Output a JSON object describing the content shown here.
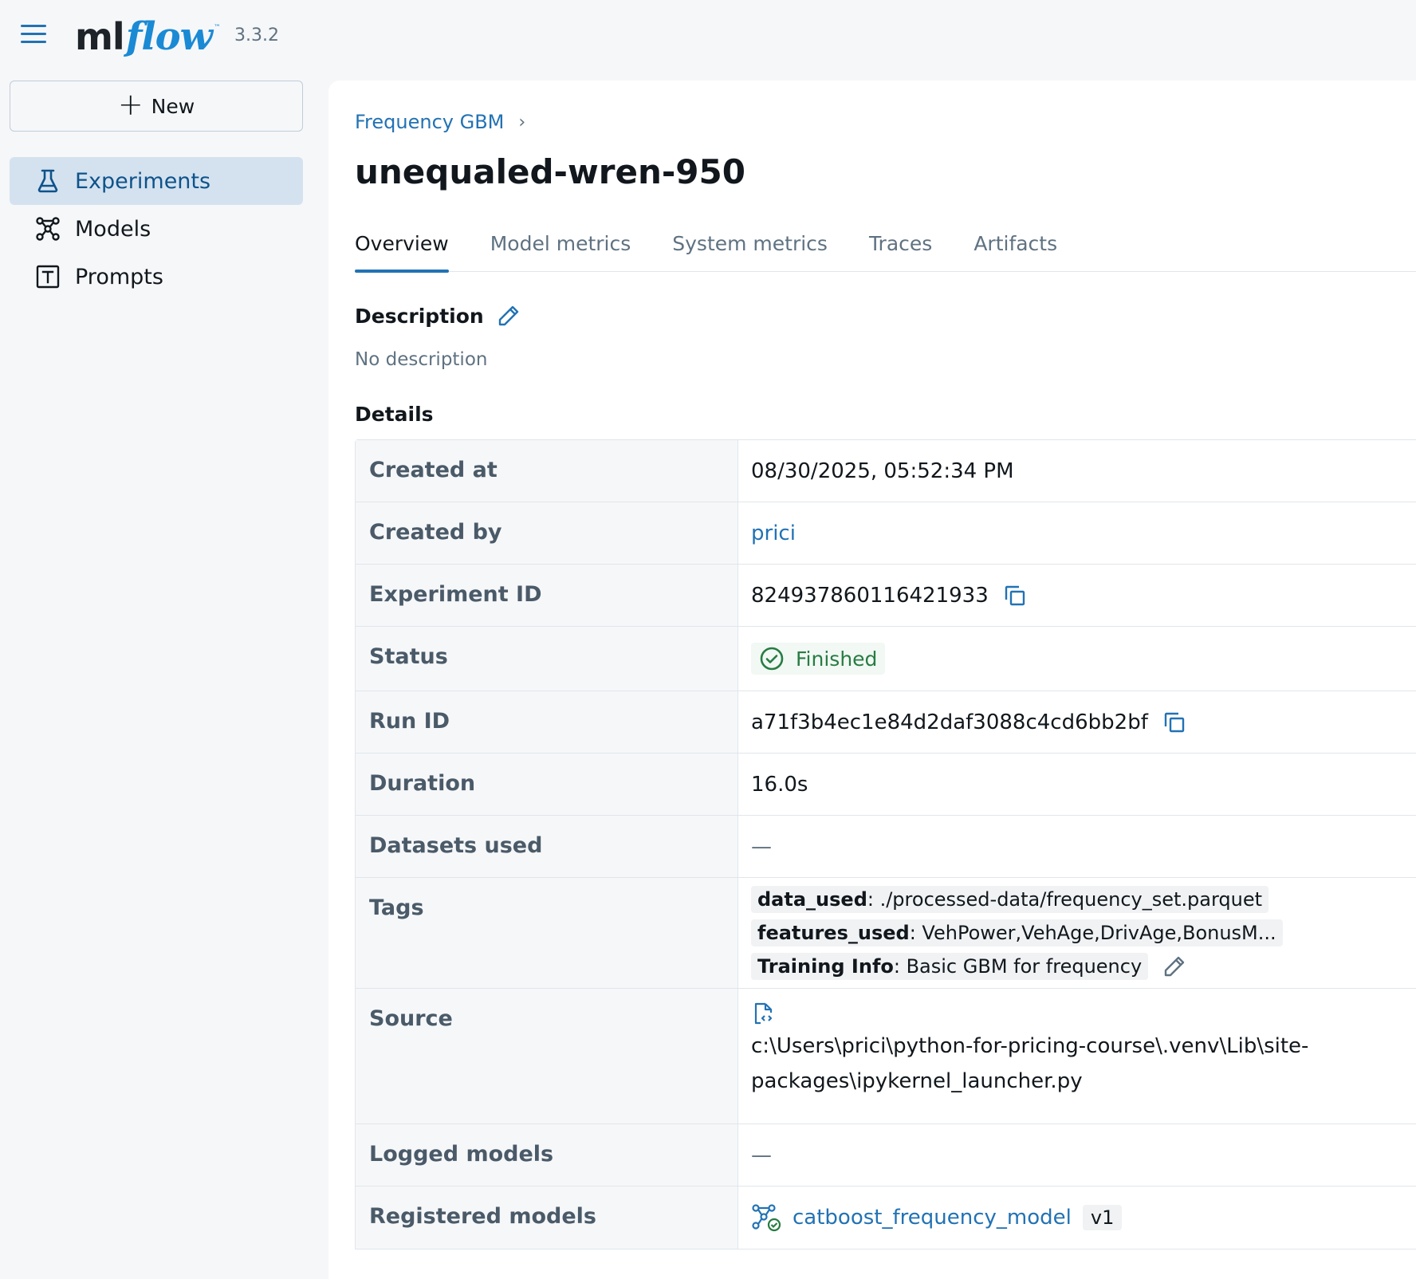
{
  "header": {
    "logo_ml": "ml",
    "logo_flow": "flow",
    "logo_tm": "™",
    "version": "3.3.2",
    "menu_icon": "hamburger-icon"
  },
  "sidebar": {
    "new_label": "New",
    "items": [
      {
        "label": "Experiments",
        "icon": "flask-icon",
        "active": true
      },
      {
        "label": "Models",
        "icon": "models-icon",
        "active": false
      },
      {
        "label": "Prompts",
        "icon": "prompts-icon",
        "active": false
      }
    ]
  },
  "breadcrumb": {
    "parent": "Frequency GBM",
    "separator": "›"
  },
  "page": {
    "title": "unequaled-wren-950"
  },
  "tabs": [
    {
      "label": "Overview",
      "active": true
    },
    {
      "label": "Model metrics",
      "active": false
    },
    {
      "label": "System metrics",
      "active": false
    },
    {
      "label": "Traces",
      "active": false
    },
    {
      "label": "Artifacts",
      "active": false
    }
  ],
  "description": {
    "heading": "Description",
    "text": "No description"
  },
  "details": {
    "heading": "Details",
    "created_at": {
      "label": "Created at",
      "value": "08/30/2025, 05:52:34 PM"
    },
    "created_by": {
      "label": "Created by",
      "value": "prici"
    },
    "experiment_id": {
      "label": "Experiment ID",
      "value": "824937860116421933"
    },
    "status": {
      "label": "Status",
      "value": "Finished"
    },
    "run_id": {
      "label": "Run ID",
      "value": "a71f3b4ec1e84d2daf3088c4cd6bb2bf"
    },
    "duration": {
      "label": "Duration",
      "value": "16.0s"
    },
    "datasets_used": {
      "label": "Datasets used",
      "value": "—"
    },
    "tags": {
      "label": "Tags",
      "items": [
        {
          "key": "data_used",
          "value": ": ./processed-data/frequency_set.parquet"
        },
        {
          "key": "features_used",
          "value": ": VehPower,VehAge,DrivAge,BonusM..."
        },
        {
          "key": "Training Info",
          "value": ": Basic GBM for frequency"
        }
      ]
    },
    "source": {
      "label": "Source",
      "value": "c:\\Users\\prici\\python-for-pricing-course\\.venv\\Lib\\site-packages\\ipykernel_launcher.py"
    },
    "logged_models": {
      "label": "Logged models",
      "value": "—"
    },
    "registered_models": {
      "label": "Registered models",
      "name": "catboost_frequency_model",
      "version": "v1"
    }
  },
  "colors": {
    "accent": "#2272b4",
    "success": "#277c43",
    "sidebar_active_bg": "#d4e2ef",
    "logo_flow": "#1a8ad4"
  }
}
